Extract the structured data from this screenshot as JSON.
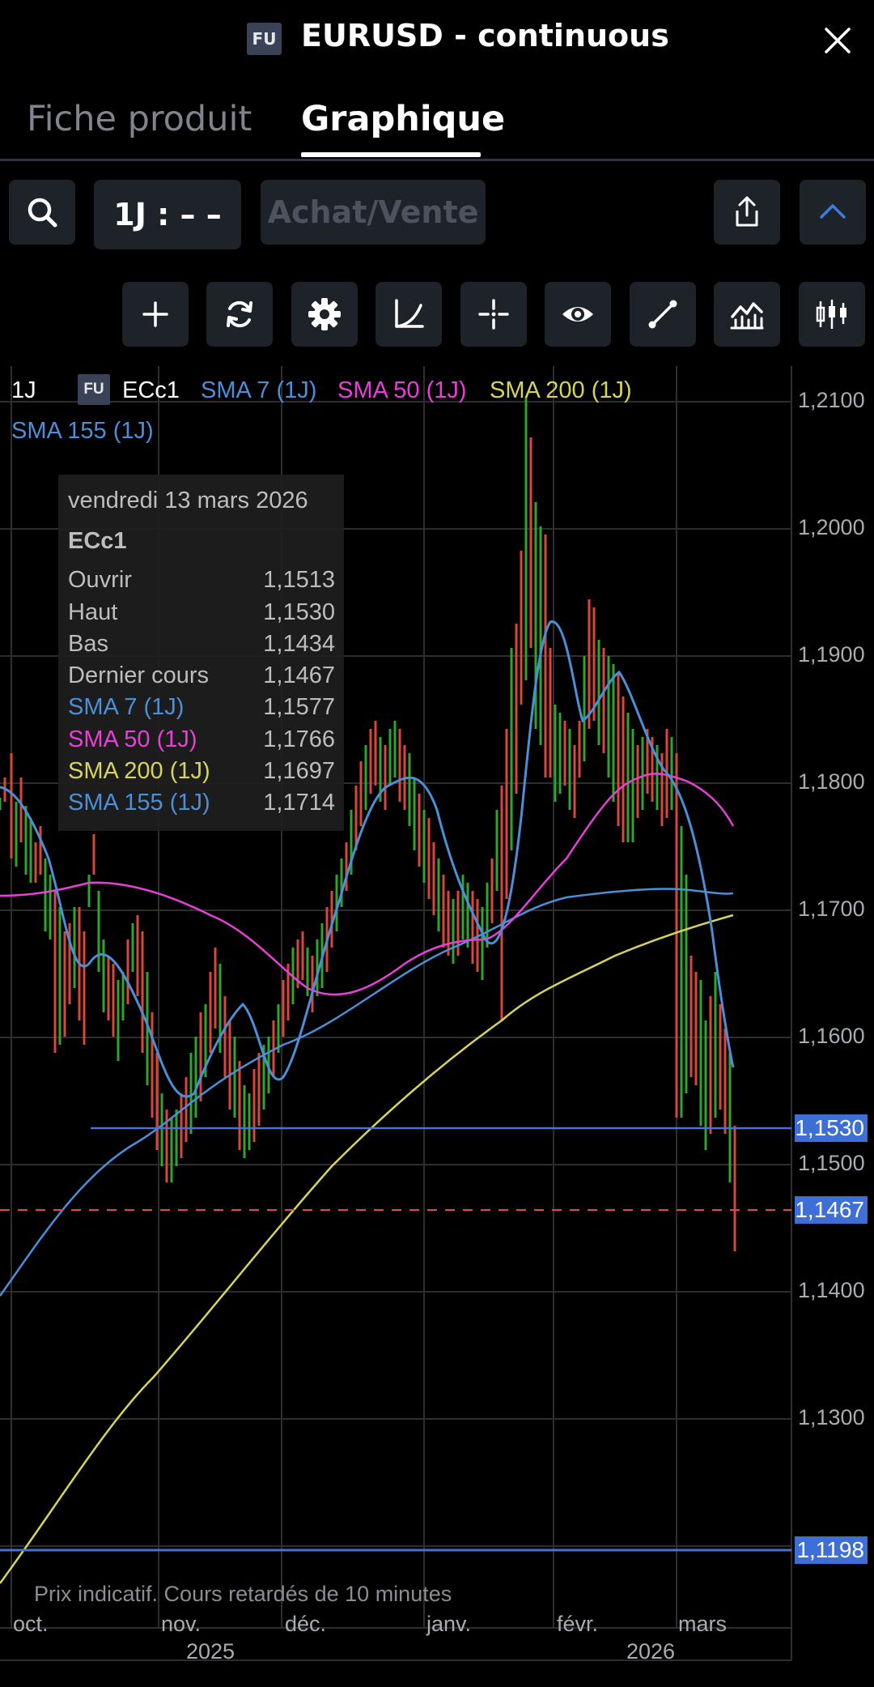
{
  "header": {
    "badge": "FU",
    "title": "EURUSD - continuous",
    "close_icon": "close-icon"
  },
  "tabs": [
    {
      "label": "Fiche produit",
      "active": false
    },
    {
      "label": "Graphique",
      "active": true
    }
  ],
  "toolbar": {
    "search_icon": "search-icon",
    "interval_label": "1J : – –",
    "trade_label": "Achat/Vente",
    "share_icon": "share-icon",
    "collapse_icon": "chevron-up-icon"
  },
  "tools": [
    "plus-icon",
    "refresh-icon",
    "gear-icon",
    "curve-icon",
    "crosshair-icon",
    "eye-icon",
    "draw-line-icon",
    "indicator-chart-icon",
    "candlestick-icon"
  ],
  "legend": {
    "interval": "1J",
    "badge": "FU",
    "symbol": "ECc1",
    "sma7": "SMA 7 (1J)",
    "sma50": "SMA 50 (1J)",
    "sma200": "SMA 200 (1J)",
    "sma155": "SMA 155 (1J)"
  },
  "tooltip": {
    "date": "vendredi 13 mars 2026",
    "symbol": "ECc1",
    "rows": [
      {
        "label": "Ouvrir",
        "value": "1,1513"
      },
      {
        "label": "Haut",
        "value": "1,1530"
      },
      {
        "label": "Bas",
        "value": "1,1434"
      },
      {
        "label": "Dernier cours",
        "value": "1,1467"
      },
      {
        "label": "SMA 7 (1J)",
        "value": "1,1577"
      },
      {
        "label": "SMA 50 (1J)",
        "value": "1,1766"
      },
      {
        "label": "SMA 200 (1J)",
        "value": "1,1697"
      },
      {
        "label": "SMA 155 (1J)",
        "value": "1,1714"
      }
    ]
  },
  "y_axis": [
    "1,2100",
    "1,2000",
    "1,1900",
    "1,1800",
    "1,1700",
    "1,1600",
    "1,1500",
    "1,1400",
    "1,1300"
  ],
  "price_tags": {
    "high": "1,1530",
    "last": "1,1467",
    "level": "1,1198"
  },
  "months": [
    "oct.",
    "nov.",
    "déc.",
    "janv.",
    "févr.",
    "mars"
  ],
  "years": [
    "2025",
    "2026"
  ],
  "note": "Prix indicatif. Cours retardés de 10 minutes",
  "colors": {
    "up": "#2ea52e",
    "down": "#d9463c",
    "sma7": "#4a8fd8",
    "sma50": "#e83fd8",
    "sma200": "#d8d45a",
    "sma155": "#4a8fd8",
    "hline": "#4a6fd6",
    "last": "#e04a4a"
  },
  "chart_data": {
    "type": "candlestick",
    "title": "",
    "ylim": [
      1.12,
      1.2115
    ],
    "indicators": [
      {
        "name": "SMA 7 (1J)",
        "last": 1.1577
      },
      {
        "name": "SMA 50 (1J)",
        "last": 1.1766
      },
      {
        "name": "SMA 200 (1J)",
        "last": 1.1697
      },
      {
        "name": "SMA 155 (1J)",
        "last": 1.1714
      }
    ],
    "last_candle": {
      "date": "vendredi 13 mars 2026",
      "open": 1.1513,
      "high": 1.153,
      "low": 1.1434,
      "close": 1.1467
    },
    "horizontal_lines": [
      1.153,
      1.1467,
      1.1198
    ]
  }
}
